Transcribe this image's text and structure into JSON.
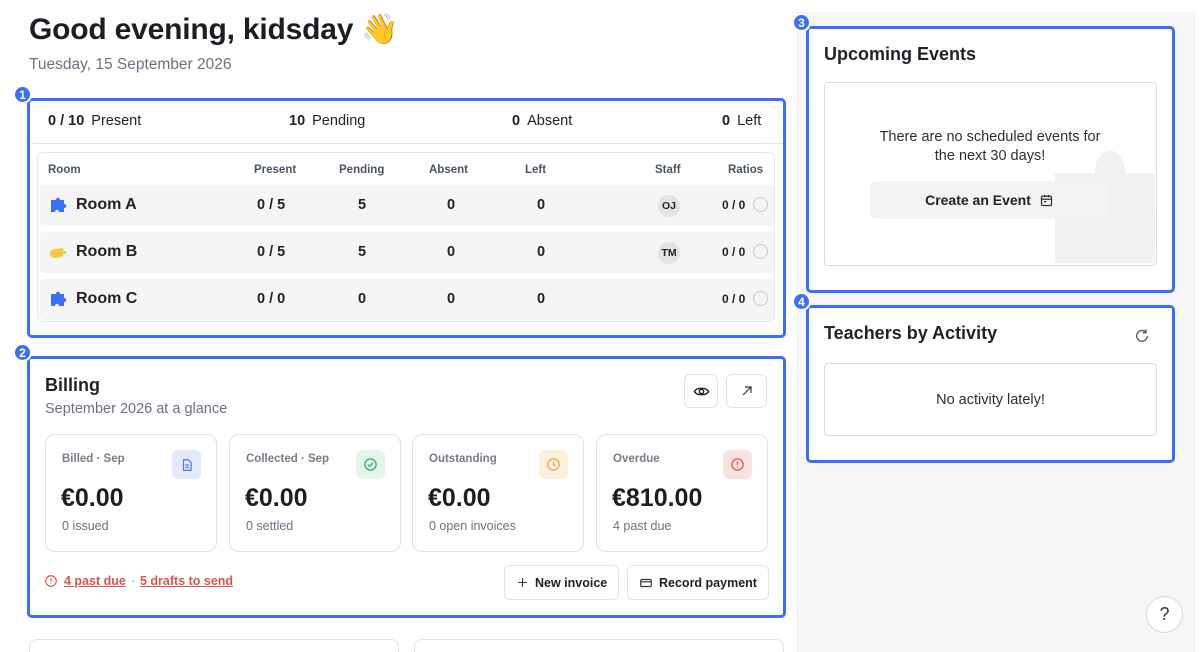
{
  "header": {
    "greeting": "Good evening, kidsday 👋",
    "date": "Tuesday, 15 September 2026"
  },
  "badges": [
    "1",
    "2",
    "3",
    "4"
  ],
  "attendance": {
    "summary": [
      {
        "value": "0 / 10",
        "label": "Present"
      },
      {
        "value": "10",
        "label": "Pending"
      },
      {
        "value": "0",
        "label": "Absent"
      },
      {
        "value": "0",
        "label": "Left"
      }
    ],
    "columns": [
      "Room",
      "Present",
      "Pending",
      "Absent",
      "Left",
      "Staff",
      "Ratios"
    ],
    "rows": [
      {
        "icon": "puzzle-icon",
        "icon_color": "#3b6ff5",
        "room": "Room A",
        "present": "0 / 5",
        "pending": "5",
        "absent": "0",
        "left": "0",
        "staff": "OJ",
        "ratio": "0 / 0"
      },
      {
        "icon": "hand-icon",
        "icon_color": "#f5c842",
        "room": "Room B",
        "present": "0 / 5",
        "pending": "5",
        "absent": "0",
        "left": "0",
        "staff": "TM",
        "ratio": "0 / 0"
      },
      {
        "icon": "puzzle-icon",
        "icon_color": "#3b6ff5",
        "room": "Room C",
        "present": "0 / 0",
        "pending": "0",
        "absent": "0",
        "left": "0",
        "staff": "",
        "ratio": "0 / 0"
      }
    ]
  },
  "billing": {
    "title": "Billing",
    "subtitle": "September 2026 at a glance",
    "cards": [
      {
        "label": "Billed · Sep",
        "amount": "€0.00",
        "sub": "0 issued",
        "icon": "document-icon",
        "icon_bg": "#e4e9fb",
        "icon_color": "#4f6ee0"
      },
      {
        "label": "Collected · Sep",
        "amount": "€0.00",
        "sub": "0 settled",
        "icon": "check-circle-icon",
        "icon_bg": "#e3f6ea",
        "icon_color": "#34a865"
      },
      {
        "label": "Outstanding",
        "amount": "€0.00",
        "sub": "0 open invoices",
        "icon": "clock-icon",
        "icon_bg": "#fcefdc",
        "icon_color": "#e8a54a"
      },
      {
        "label": "Overdue",
        "amount": "€810.00",
        "sub": "4 past due",
        "icon": "alert-icon",
        "icon_bg": "#fbe2e2",
        "icon_color": "#e0524d"
      }
    ],
    "past_due_link": "4 past due",
    "separator": "·",
    "drafts_link": "5 drafts to send",
    "new_invoice_label": "New invoice",
    "record_payment_label": "Record payment"
  },
  "events": {
    "title": "Upcoming Events",
    "empty_text": "There are no scheduled events for the next 30 days!",
    "create_label": "Create an Event"
  },
  "teachers": {
    "title": "Teachers by Activity",
    "empty_text": "No activity lately!"
  },
  "help_label": "?"
}
